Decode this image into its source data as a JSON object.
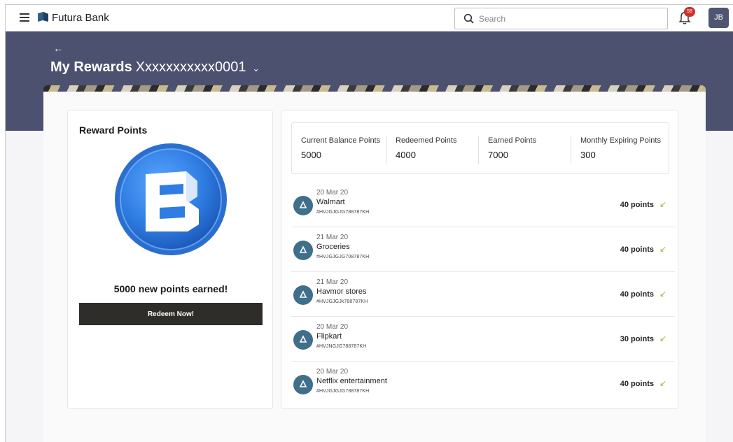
{
  "header": {
    "brand": "Futura Bank",
    "search_placeholder": "Search",
    "notification_count": "58",
    "user_initials": "JB"
  },
  "hero": {
    "back_symbol": "←",
    "title": "My Rewards",
    "account": "Xxxxxxxxxxx0001",
    "chevron": "⌄"
  },
  "reward_card": {
    "title": "Reward Points",
    "message": "5000 new points earned!",
    "button_label": "Redeem Now!"
  },
  "stats": [
    {
      "label": "Current Balance Points",
      "value": "5000"
    },
    {
      "label": "Redeemed Points",
      "value": "4000"
    },
    {
      "label": "Earned Points",
      "value": "7000"
    },
    {
      "label": "Monthly Expiring Points",
      "value": "300"
    }
  ],
  "transactions": [
    {
      "date": "20 Mar 20",
      "name": "Walmart",
      "ref": "#HVJGJGJG788787KH",
      "points": "40 points"
    },
    {
      "date": "21 Mar 20",
      "name": "Groceries",
      "ref": "#HVJGJGJG708787KH",
      "points": "40 points"
    },
    {
      "date": "21 Mar 20",
      "name": "Havmor stores",
      "ref": "#HVJGJGJk788787KH",
      "points": "40 points"
    },
    {
      "date": "20 Mar 20",
      "name": "Flipkart",
      "ref": "#HVJNGJG788787KH",
      "points": "30 points"
    },
    {
      "date": "20 Mar 20",
      "name": "Netflix entertainment",
      "ref": "#HVJGJGJG788787KH",
      "points": "40 points"
    }
  ],
  "transaction_arrow": "↙",
  "colors": {
    "hero_bg": "#4d5170",
    "button_bg": "#2f2d2a",
    "badge": "#d0302c",
    "arrow": "#8fbf3f",
    "coin": "#2f7de2"
  },
  "icons": [
    "menu-icon",
    "bank-logo-icon",
    "search-icon",
    "bell-icon",
    "back-arrow-icon",
    "coin-logo-icon",
    "merchant-icon",
    "earned-arrow-icon"
  ]
}
